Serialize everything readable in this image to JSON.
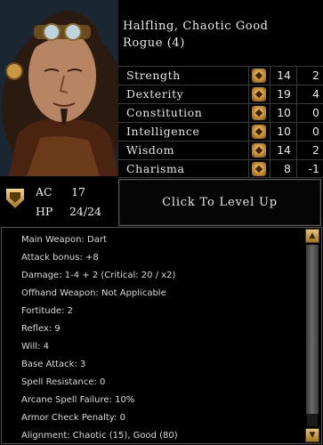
{
  "character": {
    "race_alignment": "Halfling, Chaotic Good",
    "class_level": "Rogue (4)"
  },
  "abilities": [
    {
      "name": "Strength",
      "score": "14",
      "mod": "2",
      "icon": "strength-icon"
    },
    {
      "name": "Dexterity",
      "score": "19",
      "mod": "4",
      "icon": "dexterity-icon"
    },
    {
      "name": "Constitution",
      "score": "10",
      "mod": "0",
      "icon": "constitution-icon"
    },
    {
      "name": "Intelligence",
      "score": "10",
      "mod": "0",
      "icon": "intelligence-icon"
    },
    {
      "name": "Wisdom",
      "score": "14",
      "mod": "2",
      "icon": "wisdom-icon"
    },
    {
      "name": "Charisma",
      "score": "8",
      "mod": "-1",
      "icon": "charisma-icon"
    }
  ],
  "ac": {
    "label": "AC",
    "value": "17"
  },
  "hp": {
    "label": "HP",
    "value": "24/24"
  },
  "level_up_button": "Click To Level Up",
  "details": [
    {
      "label": "Main Weapon:",
      "value": "Dart"
    },
    {
      "label": "Attack bonus:",
      "value": "+8"
    },
    {
      "label": "Damage:",
      "value": "1-4 + 2 (Critical: 20 / x2)"
    },
    {
      "label": "Offhand Weapon:",
      "value": "Not Applicable"
    },
    {
      "label": "Fortitude:",
      "value": "2"
    },
    {
      "label": "Reflex:",
      "value": "9"
    },
    {
      "label": "Will:",
      "value": "4"
    },
    {
      "label": "Base Attack:",
      "value": "3"
    },
    {
      "label": "Spell Resistance:",
      "value": "0"
    },
    {
      "label": "Arcane Spell Failure:",
      "value": "10%"
    },
    {
      "label": "Armor Check Penalty:",
      "value": "0"
    },
    {
      "label": "Alignment:",
      "value": "Chaotic (15), Good (80)"
    }
  ],
  "scrollbar": {
    "up_icon": "scroll-up-arrow-icon",
    "down_icon": "scroll-down-arrow-icon"
  },
  "colors": {
    "gold_icon": "#d9a441",
    "border": "#555555",
    "text": "#e0e0e0"
  }
}
